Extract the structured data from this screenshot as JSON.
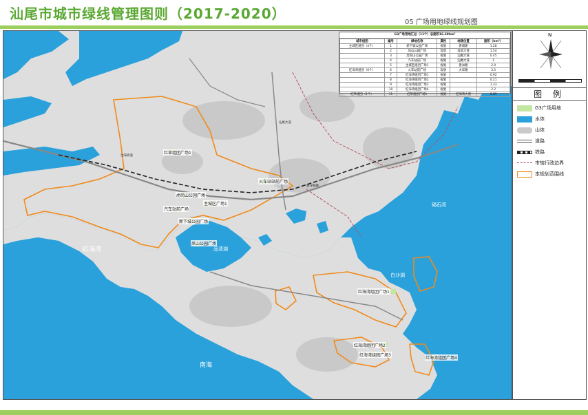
{
  "header": {
    "title": "汕尾市城市绿线管理图则（2017-2020）",
    "subtitle": "05  广场用地绿线规划图"
  },
  "colors": {
    "water": "#2aa1db",
    "land": "#dedede",
    "mountain": "#c9c9c9",
    "plaza": "#c3e6a3",
    "boundary_scope": "#f08a1a",
    "admin_boundary": "#b5505b",
    "accent": "#9ccf5e"
  },
  "legend": {
    "heading": "图 例",
    "items": [
      {
        "label": "G3广场用地",
        "icon": "green-fill"
      },
      {
        "label": "水体",
        "icon": "blue-fill"
      },
      {
        "label": "山体",
        "icon": "gray-hill"
      },
      {
        "label": "道路",
        "icon": "road-double-line"
      },
      {
        "label": "铁路",
        "icon": "railway-line"
      },
      {
        "label": "市辖行政边界",
        "icon": "red-dash-line"
      },
      {
        "label": "本规划范围线",
        "icon": "orange-outline"
      }
    ]
  },
  "compass": {
    "north_label": "N"
  },
  "plaza_table": {
    "title": "G3广场用地汇总（11个）总面积16.68hm²",
    "headers": [
      "城市组团",
      "编号",
      "绿地名称",
      "属性",
      "地理位置",
      "面积（hm²）"
    ],
    "rows": [
      [
        "主城区组团（4个）",
        "1",
        "新下城公园广场",
        "规划",
        "香城路",
        "1.28"
      ],
      [
        "",
        "2",
        "凤山公园广场",
        "现状",
        "海滨大道",
        "1.54"
      ],
      [
        "",
        "3",
        "虎岗山公园广场",
        "规划",
        "汕尾大道",
        "0.45"
      ],
      [
        "",
        "4",
        "汽车站前广场",
        "规划",
        "汕尾大道",
        "1"
      ],
      [
        "",
        "5",
        "主城区组团广场1",
        "规划",
        "香洲路",
        "2.9"
      ],
      [
        "红海湾组团（6个）",
        "6",
        "火车站前广场",
        "现状",
        "大华路",
        "3.5"
      ],
      [
        "",
        "7",
        "红海湾组团广场1",
        "规划",
        "",
        "0.92"
      ],
      [
        "",
        "8",
        "红海湾组团广场2",
        "规划",
        "",
        "0.21"
      ],
      [
        "",
        "9",
        "红海湾组团广场3",
        "规划",
        "",
        "1.33"
      ],
      [
        "",
        "10",
        "红海湾组团广场4",
        "规划",
        "",
        "2.2"
      ],
      [
        "红草组团（1个）",
        "11",
        "红草组团广场1",
        "规划",
        "红海湾大道",
        "0.89"
      ]
    ]
  },
  "map_labels": {
    "honghai_bay": "红海湾",
    "nan_hai": "南海",
    "pinqing_lake": "品清湖",
    "baisha_lake": "白沙湖",
    "yaoshi_bay": "碣石湾"
  },
  "plaza_labels": [
    "红草组团广场1",
    "火车站站前广场",
    "虎岗山公园广场",
    "主城区广场1",
    "汽车站前广场",
    "新下城公园广场",
    "凤山公园广场",
    "红海湾组团广场1",
    "红海湾组团广场2",
    "红海湾组团广场3",
    "红海湾组团广场4"
  ],
  "road_labels": [
    "汕尾大道",
    "沈海高速",
    "厦深铁路"
  ]
}
